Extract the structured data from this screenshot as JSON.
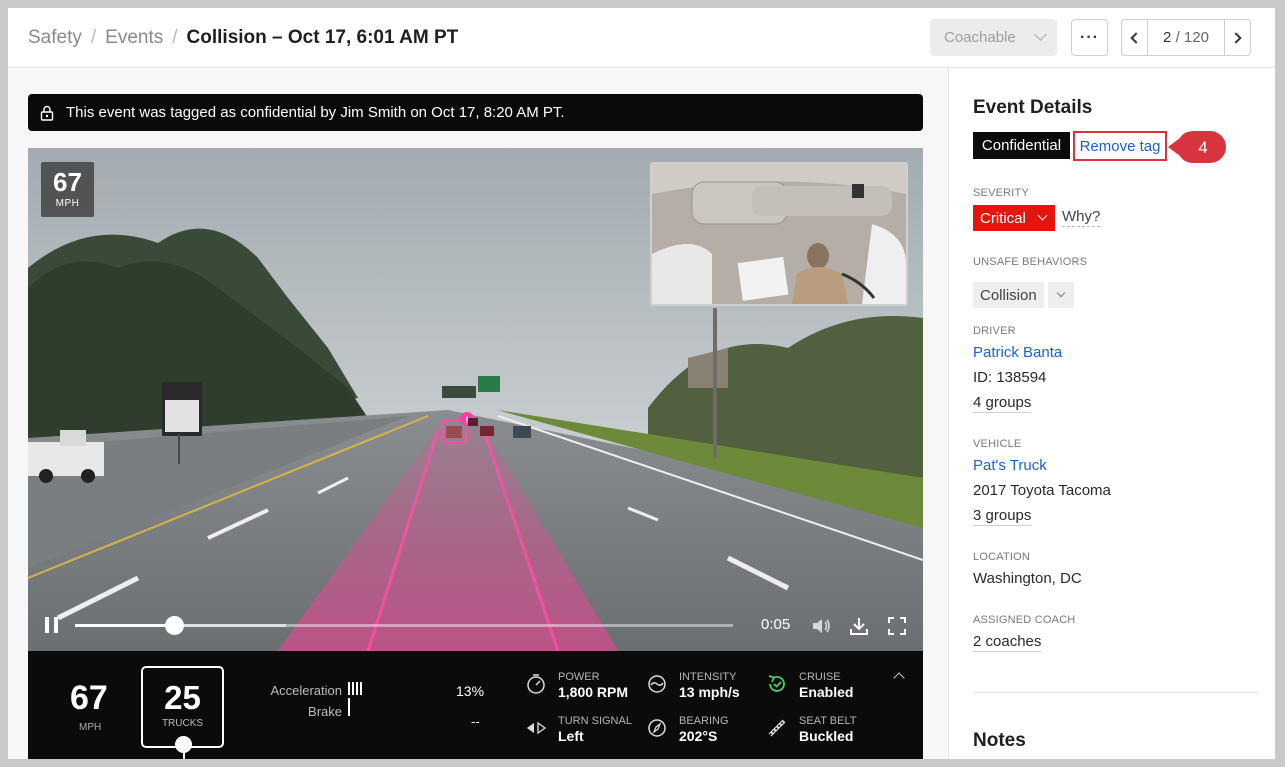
{
  "breadcrumb": {
    "items": [
      "Safety",
      "Events"
    ],
    "separator": "/",
    "current": "Collision – Oct 17, 6:01 AM PT"
  },
  "toolbar": {
    "coach_status": "Coachable",
    "more_label": "···",
    "pager_current": "2",
    "pager_separator": "/",
    "pager_total": "120"
  },
  "banner": {
    "text": "This event was tagged as confidential by Jim Smith on Oct 17, 8:20 AM PT."
  },
  "video": {
    "speed_value": "67",
    "speed_unit": "MPH",
    "time": "0:05",
    "progress": 0.15,
    "buffered": 0.32
  },
  "telemetry": {
    "speed": "67",
    "speed_unit": "MPH",
    "limit": "25",
    "limit_label": "TRUCKS",
    "acceleration_label": "Acceleration",
    "brake_label": "Brake",
    "acceleration_value": "13%",
    "brake_value": "--",
    "stats": [
      {
        "label": "POWER",
        "value": "1,800 RPM",
        "icon": "gauge-icon"
      },
      {
        "label": "INTENSITY",
        "value": "13 mph/s",
        "icon": "intensity-icon"
      },
      {
        "label": "CRUISE",
        "value": "Enabled",
        "icon": "cruise-icon"
      },
      {
        "label": "TURN SIGNAL",
        "value": "Left",
        "icon": "turn-signal-icon"
      },
      {
        "label": "BEARING",
        "value": "202°S",
        "icon": "compass-icon"
      },
      {
        "label": "SEAT BELT",
        "value": "Buckled",
        "icon": "seatbelt-icon"
      }
    ]
  },
  "details": {
    "title": "Event Details",
    "tag": "Confidential",
    "remove_tag": "Remove tag",
    "callout_number": "4",
    "severity_label": "SEVERITY",
    "severity_value": "Critical",
    "why": "Why?",
    "behaviors_label": "UNSAFE BEHAVIORS",
    "behavior": "Collision",
    "driver_label": "DRIVER",
    "driver_name": "Patrick Banta",
    "driver_id": "ID: 138594",
    "driver_groups": "4 groups",
    "vehicle_label": "VEHICLE",
    "vehicle_name": "Pat's Truck",
    "vehicle_model": "2017 Toyota Tacoma",
    "vehicle_groups": "3 groups",
    "location_label": "LOCATION",
    "location_value": "Washington, DC",
    "coach_label": "ASSIGNED COACH",
    "coach_value": "2 coaches",
    "notes_title": "Notes"
  },
  "colors": {
    "severity": "#e3150d",
    "link": "#1b63c8",
    "callout": "#d8343e",
    "lane_overlay": "#ff3d9a"
  }
}
